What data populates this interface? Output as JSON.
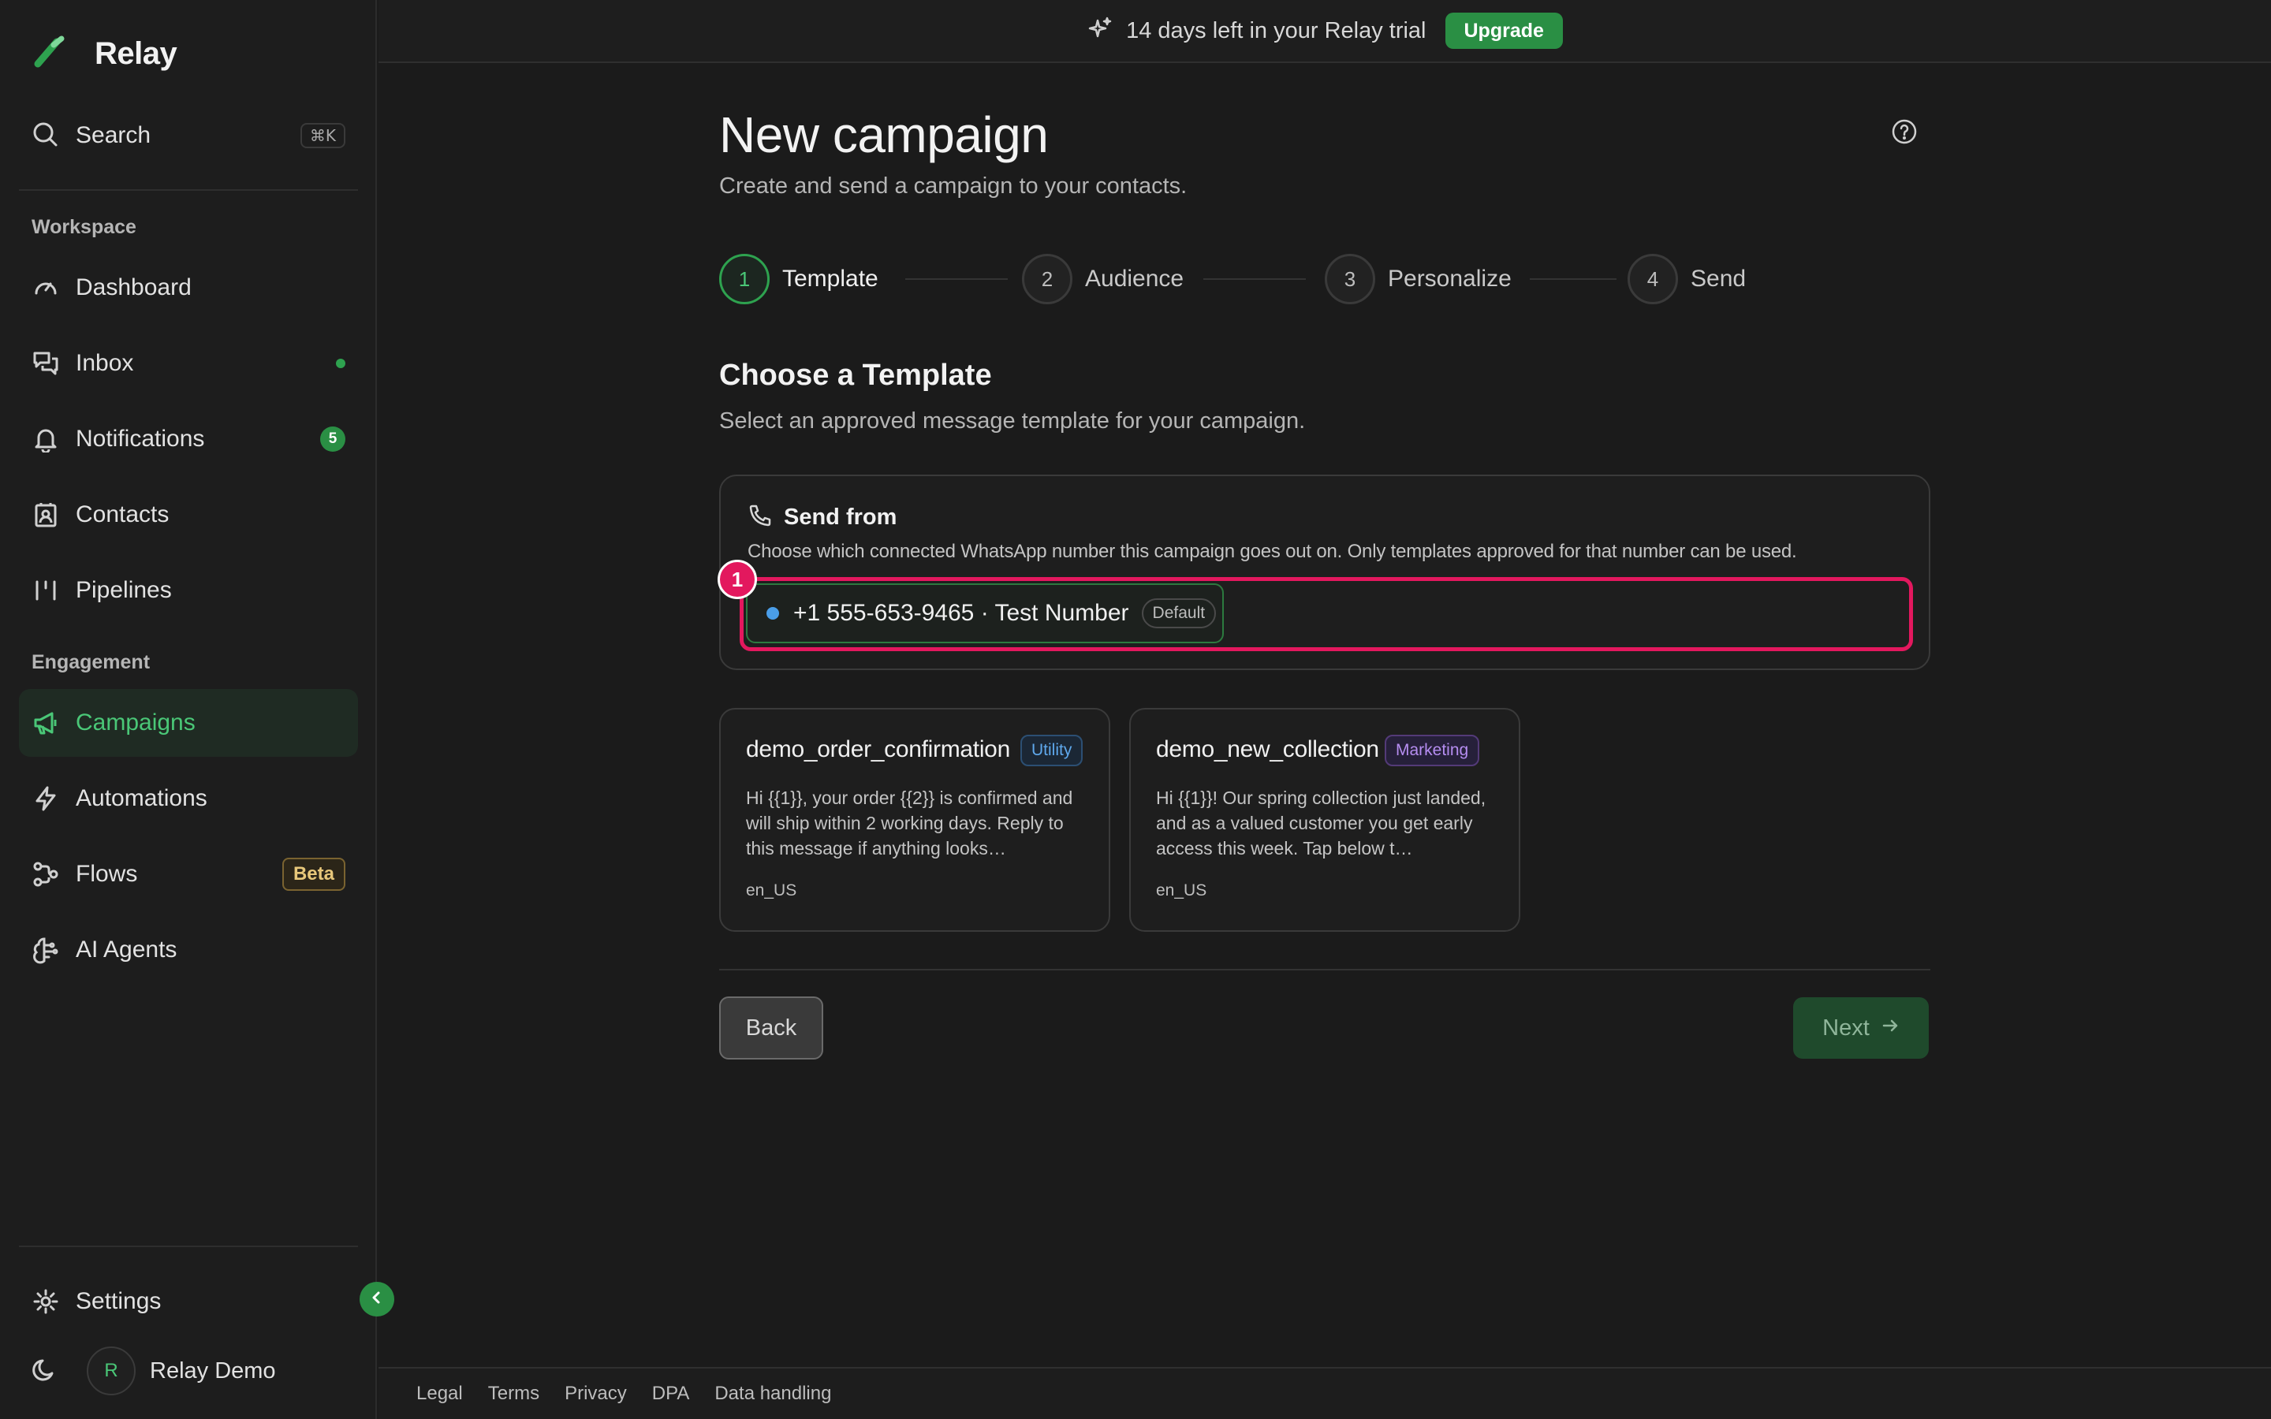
{
  "brand": {
    "name": "Relay"
  },
  "search": {
    "label": "Search",
    "shortcut": "⌘K"
  },
  "sidebar": {
    "workspace_title": "Workspace",
    "engagement_title": "Engagement",
    "workspace_items": [
      {
        "label": "Dashboard",
        "icon": "gauge-icon"
      },
      {
        "label": "Inbox",
        "icon": "chat-icon",
        "indicator": "green-dot"
      },
      {
        "label": "Notifications",
        "icon": "bell-icon",
        "count": "5"
      },
      {
        "label": "Contacts",
        "icon": "contacts-icon"
      },
      {
        "label": "Pipelines",
        "icon": "pipeline-icon"
      }
    ],
    "engagement_items": [
      {
        "label": "Campaigns",
        "icon": "megaphone-icon",
        "active": true
      },
      {
        "label": "Automations",
        "icon": "bolt-icon"
      },
      {
        "label": "Flows",
        "icon": "flow-icon",
        "badge": "Beta"
      },
      {
        "label": "AI Agents",
        "icon": "brain-icon"
      }
    ],
    "settings_label": "Settings",
    "user": {
      "initial": "R",
      "name": "Relay Demo"
    }
  },
  "banner": {
    "text": "14 days left in your Relay trial",
    "button": "Upgrade"
  },
  "page": {
    "title": "New campaign",
    "subtitle": "Create and send a campaign to your contacts."
  },
  "steps": [
    {
      "number": "1",
      "label": "Template",
      "active": true
    },
    {
      "number": "2",
      "label": "Audience"
    },
    {
      "number": "3",
      "label": "Personalize"
    },
    {
      "number": "4",
      "label": "Send"
    }
  ],
  "template_section": {
    "heading": "Choose a Template",
    "description": "Select an approved message template for your campaign."
  },
  "send_from": {
    "title": "Send from",
    "description": "Choose which connected WhatsApp number this campaign goes out on. Only templates approved for that number can be used.",
    "marker": "1",
    "number": "+1 555-653-9465 · Test Number",
    "default_badge": "Default"
  },
  "templates": [
    {
      "name": "demo_order_confirmation",
      "category": "Utility",
      "body": "Hi {{1}}, your order {{2}} is confirmed and will ship within 2 working days. Reply to this message if anything looks…",
      "language": "en_US"
    },
    {
      "name": "demo_new_collection",
      "category": "Marketing",
      "body": "Hi {{1}}! Our spring collection just landed, and as a valued customer you get early access this week. Tap below t…",
      "language": "en_US"
    }
  ],
  "actions": {
    "back": "Back",
    "next": "Next"
  },
  "footer": {
    "links": [
      "Legal",
      "Terms",
      "Privacy",
      "DPA",
      "Data handling"
    ]
  },
  "colors": {
    "accent": "#2a8f44",
    "accent_text": "#4ac777",
    "highlight": "#e3185e",
    "utility": "#5fa8ec",
    "marketing": "#b58df0",
    "beta": "#e7c77a"
  }
}
